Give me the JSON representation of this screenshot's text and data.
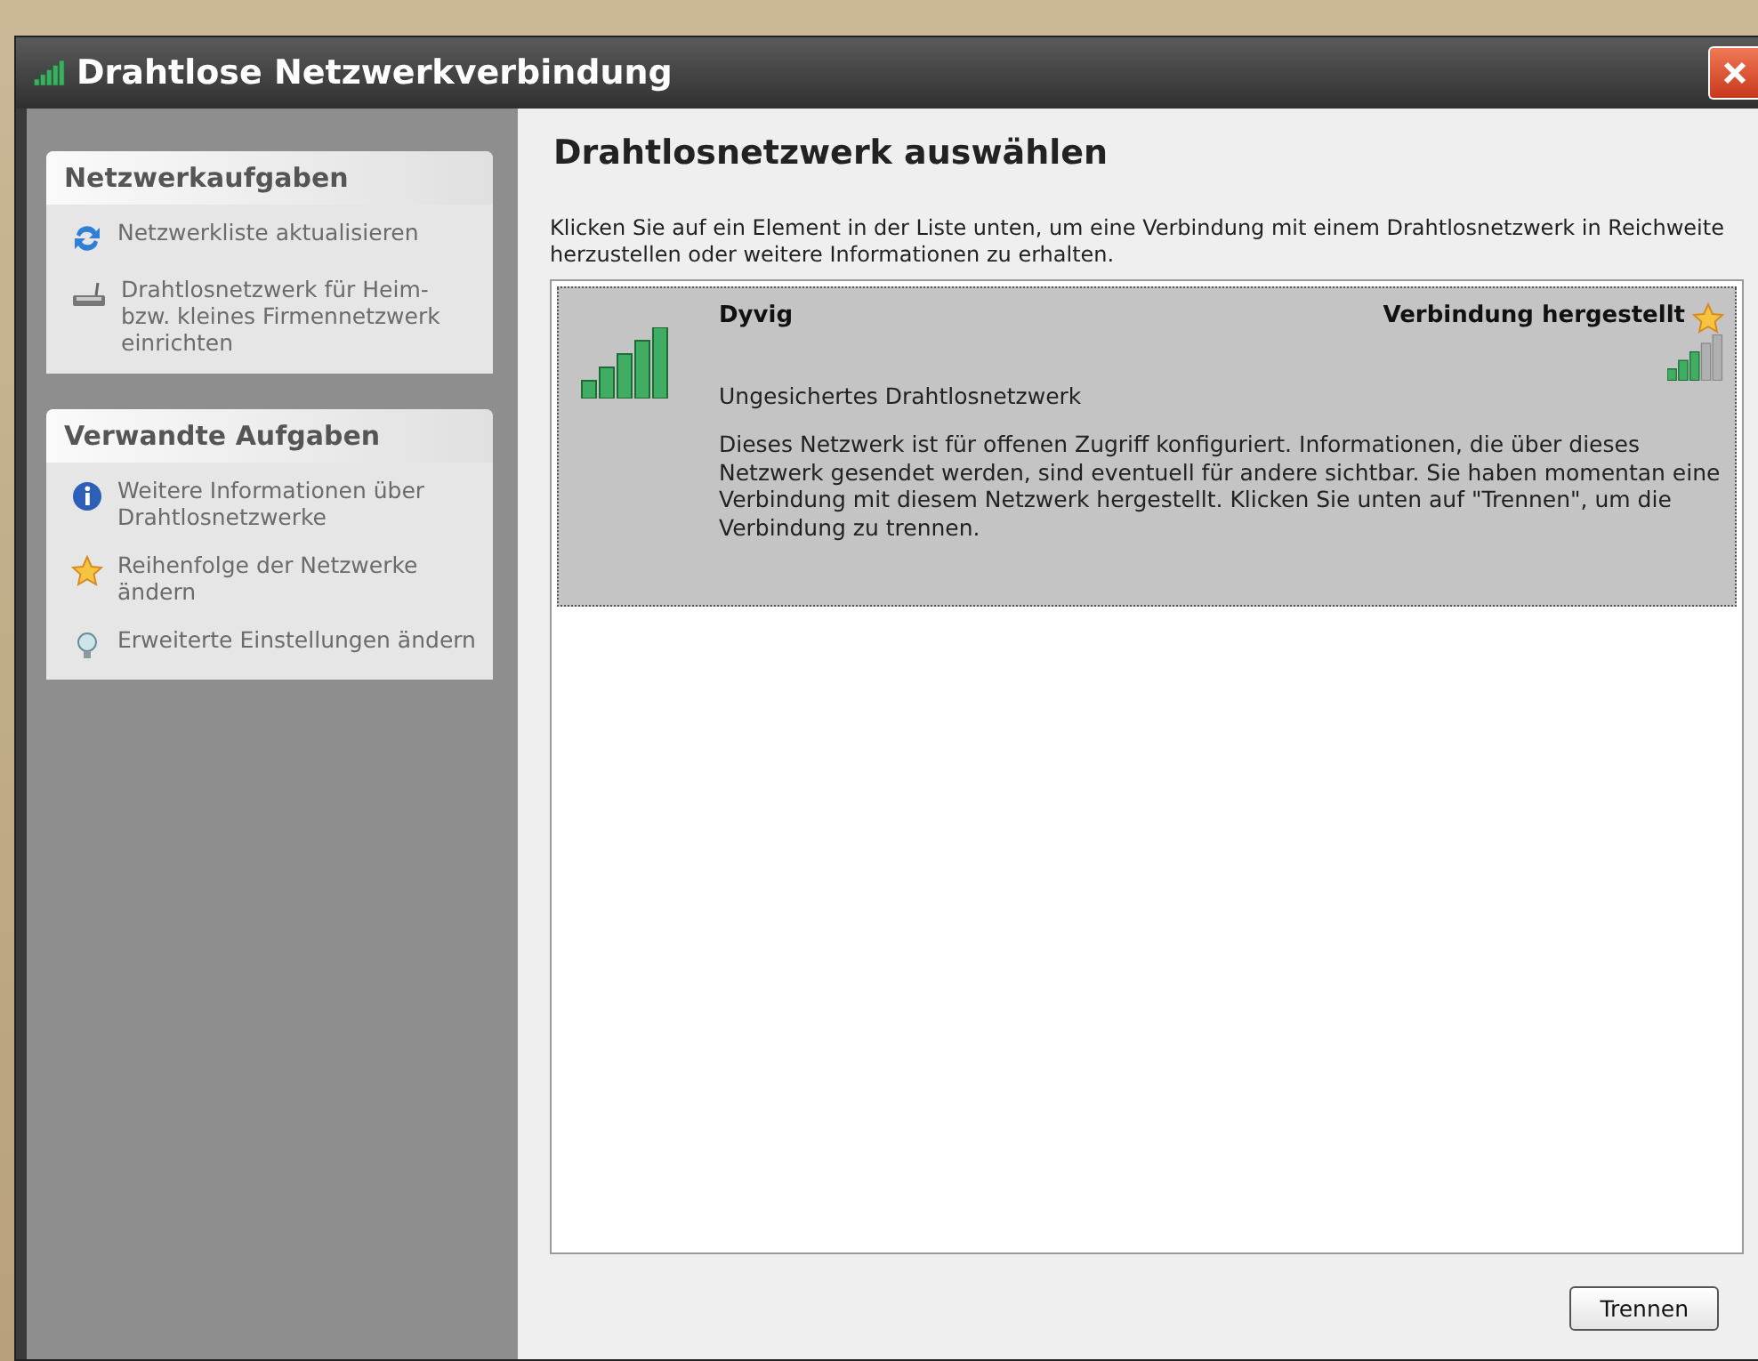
{
  "window": {
    "title": "Drahtlose Netzwerkverbindung"
  },
  "sidebar": {
    "panels": [
      {
        "title": "Netzwerkaufgaben",
        "items": [
          {
            "label": "Netzwerkliste aktualisieren",
            "kind": "refresh"
          },
          {
            "label": "Drahtlosnetzwerk für Heim- bzw. kleines Firmennetzwerk einrichten",
            "kind": "router"
          }
        ]
      },
      {
        "title": "Verwandte Aufgaben",
        "items": [
          {
            "label": "Weitere Informationen über Drahtlosnetzwerke",
            "kind": "info"
          },
          {
            "label": "Reihenfolge der Netzwerke ändern",
            "kind": "star"
          },
          {
            "label": "Erweiterte Einstellungen ändern",
            "kind": "advanced"
          }
        ]
      }
    ]
  },
  "content": {
    "heading": "Drahtlosnetzwerk auswählen",
    "description": "Klicken Sie auf ein Element in der Liste unten, um eine Verbindung mit einem Drahtlosnetzwerk in Reichweite herzustellen oder weitere Informationen zu erhalten.",
    "networks": [
      {
        "name": "Dyvig",
        "security": "Ungesichertes Drahtlosnetzwerk",
        "status": "Verbindung hergestellt",
        "selected": true,
        "details": "Dieses Netzwerk ist für offenen Zugriff konfiguriert. Informationen, die über dieses Netzwerk gesendet werden, sind eventuell für andere sichtbar. Sie haben momentan eine Verbindung mit diesem Netzwerk hergestellt. Klicken Sie unten auf \"Trennen\", um die Verbindung zu trennen."
      }
    ],
    "buttons": [
      "Trennen"
    ]
  }
}
